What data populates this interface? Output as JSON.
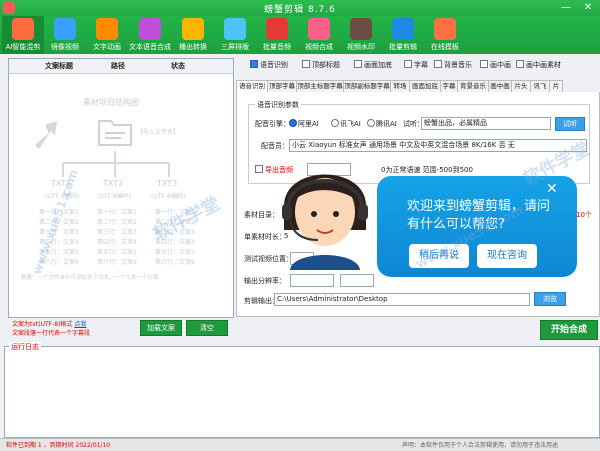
{
  "window": {
    "title": "螃蟹剪辑 8.7.6",
    "minimize": "—",
    "close": "✕"
  },
  "toolbar": [
    {
      "label": "AI智能混剪",
      "color": "#ff6b3d",
      "active": true
    },
    {
      "label": "镜像视频",
      "color": "#3aa0ff"
    },
    {
      "label": "文字动画",
      "color": "#ff8a00"
    },
    {
      "label": "文本语音合成",
      "color": "#c04fd8"
    },
    {
      "label": "播出转换",
      "color": "#ffb400"
    },
    {
      "label": "三屏排版",
      "color": "#4fc3f7"
    },
    {
      "label": "批量音频",
      "color": "#e53935"
    },
    {
      "label": "视频合成",
      "color": "#ff5f8a"
    },
    {
      "label": "视频水印",
      "color": "#6d4c41"
    },
    {
      "label": "批量剪辑",
      "color": "#1e88e5"
    },
    {
      "label": "在线模板",
      "color": "#ff7043"
    }
  ],
  "left_panel": {
    "headers": [
      "文案标题",
      "路径",
      "状态"
    ],
    "diagram_title": "素材项目结构图",
    "folder_hint": "【导入文件夹】",
    "txt_nodes": [
      {
        "name": "TXT1",
        "encoding": "(UTF-8编码)"
      },
      {
        "name": "TXT2",
        "encoding": "(UTF-8编码)"
      },
      {
        "name": "TXT3",
        "encoding": "(UTF-8编码)"
      }
    ],
    "node_lines": [
      "第一行：文案1",
      "第二行：文案2",
      "第三行：文案3",
      "第四行：文案4",
      "第五行：文案5",
      "第六行：文案6"
    ],
    "footer_hint": "数量：一个文件夹中可添加多个文本，一个文本一个行案",
    "note1": "文案为txt(UTF-8)格式",
    "note1_link": "点我",
    "note2": "文案段落一行代表一个字幕段",
    "add_button": "加载文案",
    "clear_button": "清空"
  },
  "options": [
    {
      "label": "语音识别",
      "checked": true
    },
    {
      "label": "顶部标题",
      "checked": false
    },
    {
      "label": "画面加底",
      "checked": false
    },
    {
      "label": "字幕",
      "checked": false
    },
    {
      "label": "背景音乐",
      "checked": false
    },
    {
      "label": "画中画",
      "checked": false
    },
    {
      "label": "画中画素材",
      "checked": false
    }
  ],
  "subtabs": [
    "语音识别",
    "顶部字幕",
    "顶部主标题字幕",
    "顶部副标题字幕",
    "转场",
    "画面加底",
    "字幕",
    "背景音乐",
    "画中画",
    "片头",
    "讯飞",
    "片"
  ],
  "voice": {
    "group": "语音识别参数",
    "provider_label": "配音引擎：",
    "providers": [
      {
        "label": "阿里AI",
        "selected": true
      },
      {
        "label": "讯飞AI",
        "selected": false
      },
      {
        "label": "腾讯AI",
        "selected": false
      }
    ],
    "trial_label": "试听：",
    "trial_text": "螃蟹出品，必属精品",
    "trial_button": "试听",
    "voice_label": "配音员：",
    "voice_value": "小云 Xiaoyun 标准女声 通用场景 中文及中英文混合场景 8K/16K 否 无",
    "export_label": "导出音频",
    "speed_label": "0为正常语速 范围-500到500"
  },
  "settings": {
    "material_label": "素材目录：",
    "material_hint": "字号10个",
    "duration_label": "单素材时长：",
    "duration_value": "5",
    "position_label": "测试视频位置：",
    "resolution_label": "输出分辨率：",
    "output_label": "剪辑输出：",
    "output_path": "C:\\Users\\Administrator\\Desktop",
    "browse_button": "浏览"
  },
  "chat": {
    "line1": "欢迎来到螃蟹剪辑，请问",
    "line2": "有什么可以帮您?",
    "later": "稍后再说",
    "consult": "现在咨询",
    "close": "✕"
  },
  "start_button": "开始合成",
  "log": {
    "title": "运行日志"
  },
  "status": {
    "left": "软件已到期 1 ，到期时间 2022/01/10",
    "right": "声明：本软件仅用于个人合法剪辑使用，请勿用于违法用途"
  },
  "watermarks": [
    "软件学堂",
    "www.xue51.com"
  ]
}
